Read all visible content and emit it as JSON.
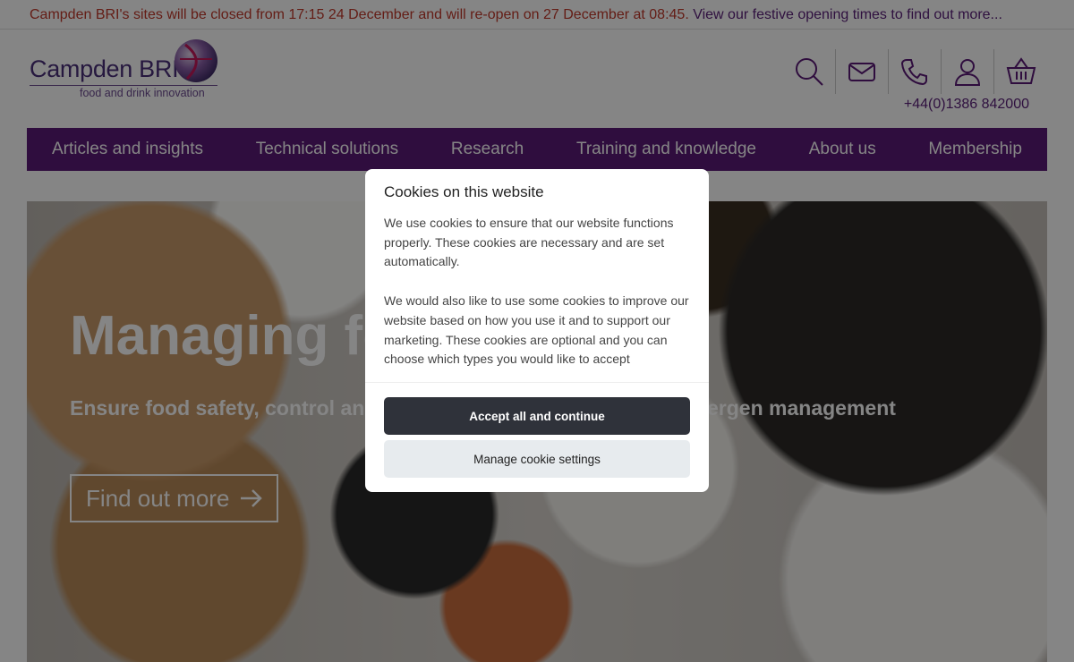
{
  "banner": {
    "alert_text": "Campden BRI's sites will be closed from 17:15 24 December and will re-open on 27 December at 08:45.",
    "link_text": "View our festive opening times to find out more..."
  },
  "logo": {
    "name": "Campden BRI",
    "tagline": "food and drink innovation"
  },
  "header": {
    "icons": [
      "search-icon",
      "mail-icon",
      "phone-icon",
      "user-icon",
      "basket-icon"
    ],
    "phone": "+44(0)1386 842000"
  },
  "nav": {
    "items": [
      {
        "label": "Articles and insights"
      },
      {
        "label": "Technical solutions"
      },
      {
        "label": "Research"
      },
      {
        "label": "Training and knowledge"
      },
      {
        "label": "About us"
      },
      {
        "label": "Membership"
      }
    ]
  },
  "hero": {
    "title_visible": "Managing fo",
    "subtitle_left": "Ensure food safety, control and",
    "subtitle_right": "ergen management",
    "cta": "Find out more"
  },
  "cookie_modal": {
    "title": "Cookies on this website",
    "paragraph1": "We use cookies to ensure that our website functions properly. These cookies are necessary and are set automatically.",
    "paragraph2": "We would also like to use some cookies to improve our website based on how you use it and to support our marketing. These cookies are optional and you can choose which types you would like to accept",
    "accept_label": "Accept all and continue",
    "manage_label": "Manage cookie settings"
  },
  "colors": {
    "brand_purple": "#5b1a78",
    "alert_red": "#c0392b",
    "accept_button": "#2f323a",
    "manage_button": "#e7ebee"
  }
}
